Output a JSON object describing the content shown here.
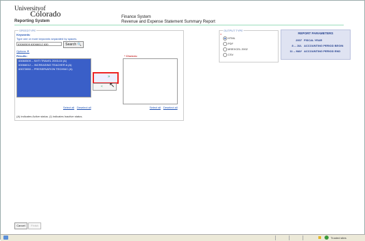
{
  "header": {
    "univ_word": "University",
    "univ_of": "of",
    "colorado": "Colorado",
    "reporting_system": "Reporting System",
    "title_line1": "Finance System",
    "title_line2": "Revenue and Expense Statement Summary Report"
  },
  "search": {
    "legend": "SPEEDTYPE",
    "keywords_label": "Keywords:",
    "keywords_hint": "Type one or more keywords separated by spaces.",
    "keywords_value": "63060509 63066012 630",
    "search_button": "Search",
    "options_link": "Options",
    "results_label": "Results:",
    "results": [
      "63060509 -- NVTI TRAVEL 2003-04 (A)",
      "63066012 -- INCREASING TEACHER A (A)",
      "63072650 -- PRESERVATION TECHNIC (A)"
    ],
    "choices_label": "Choices:",
    "select_all": "Select all",
    "deselect_all": "Deselect all",
    "status_note": "(A) indicates Active status. (I) indicates Inactive status."
  },
  "output": {
    "legend": "OUTPUT TYPE",
    "options": [
      "HTML",
      "PDF",
      "MSEXCEL 2002",
      "CSV"
    ],
    "selected": "HTML"
  },
  "params": {
    "heading": "REPORT PARAMETERS",
    "rows": [
      {
        "value": "2007",
        "label": "FISCAL YEAR"
      },
      {
        "value": "8 -- JUL",
        "label": "ACCOUNTING PERIOD BEGIN"
      },
      {
        "value": "11 -- MAY",
        "label": "ACCOUNTING PERIOD END"
      }
    ]
  },
  "footer": {
    "cancel": "Cancel",
    "finish": "Finish"
  },
  "statusbar": {
    "zone": "Trusted sites"
  }
}
